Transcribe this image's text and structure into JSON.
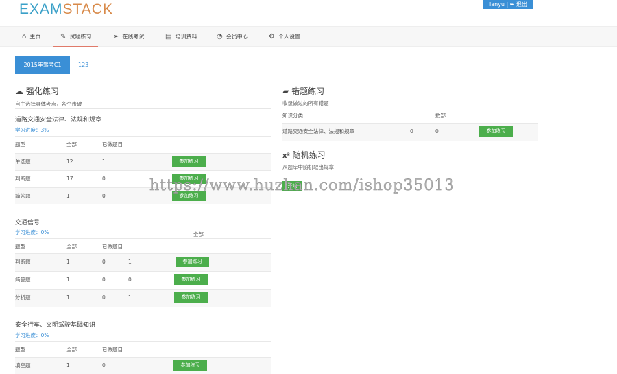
{
  "header": {
    "logo_a": "EXAM",
    "logo_b": "STACK",
    "user": "lanyu | ➥ 退出"
  },
  "nav": [
    {
      "label": "主页",
      "icon": "⌂"
    },
    {
      "label": "试题练习",
      "icon": "✎"
    },
    {
      "label": "在线考试",
      "icon": "➢"
    },
    {
      "label": "培训资料",
      "icon": "▤"
    },
    {
      "label": "会员中心",
      "icon": "◔"
    },
    {
      "label": "个人设置",
      "icon": "⚙"
    }
  ],
  "tabs": [
    "2015年驾考C1",
    "123"
  ],
  "practice": {
    "title": "强化练习",
    "subtitle": "自主选择具体考点，各个击破",
    "headers": [
      "题型",
      "全部",
      "已做题目"
    ],
    "button": "参加练习",
    "categories": [
      {
        "name": "道路交通安全法律、法规和规章",
        "progress": "学习进度：3%",
        "rows": [
          [
            "单选题",
            "12",
            "1"
          ],
          [
            "判断题",
            "17",
            "0"
          ],
          [
            "简答题",
            "1",
            "0"
          ]
        ]
      },
      {
        "name": "交通信号",
        "progress": "学习进度：0%",
        "extra_header": "全部",
        "rows": [
          [
            "判断题",
            "1",
            "0",
            "1"
          ],
          [
            "简答题",
            "1",
            "0",
            "0"
          ],
          [
            "分析题",
            "1",
            "0",
            "1"
          ]
        ]
      },
      {
        "name": "安全行车、文明驾驶基础知识",
        "progress": "学习进度：0%",
        "rows": [
          [
            "填空题",
            "1",
            "0"
          ]
        ]
      }
    ]
  },
  "wrong": {
    "title": "错题练习",
    "subtitle": "收录做过的所有错题",
    "headers": [
      "知识分类",
      "数部"
    ],
    "rows": [
      [
        "道路交通安全法律、法规和规章",
        "0",
        "0"
      ]
    ],
    "button": "参加练习"
  },
  "random": {
    "title": "随机练习",
    "icon": "x²",
    "subtitle": "从题库中随机取出规章",
    "button": "开始"
  },
  "watermark": "https://www.huzhan.com/ishop35013"
}
